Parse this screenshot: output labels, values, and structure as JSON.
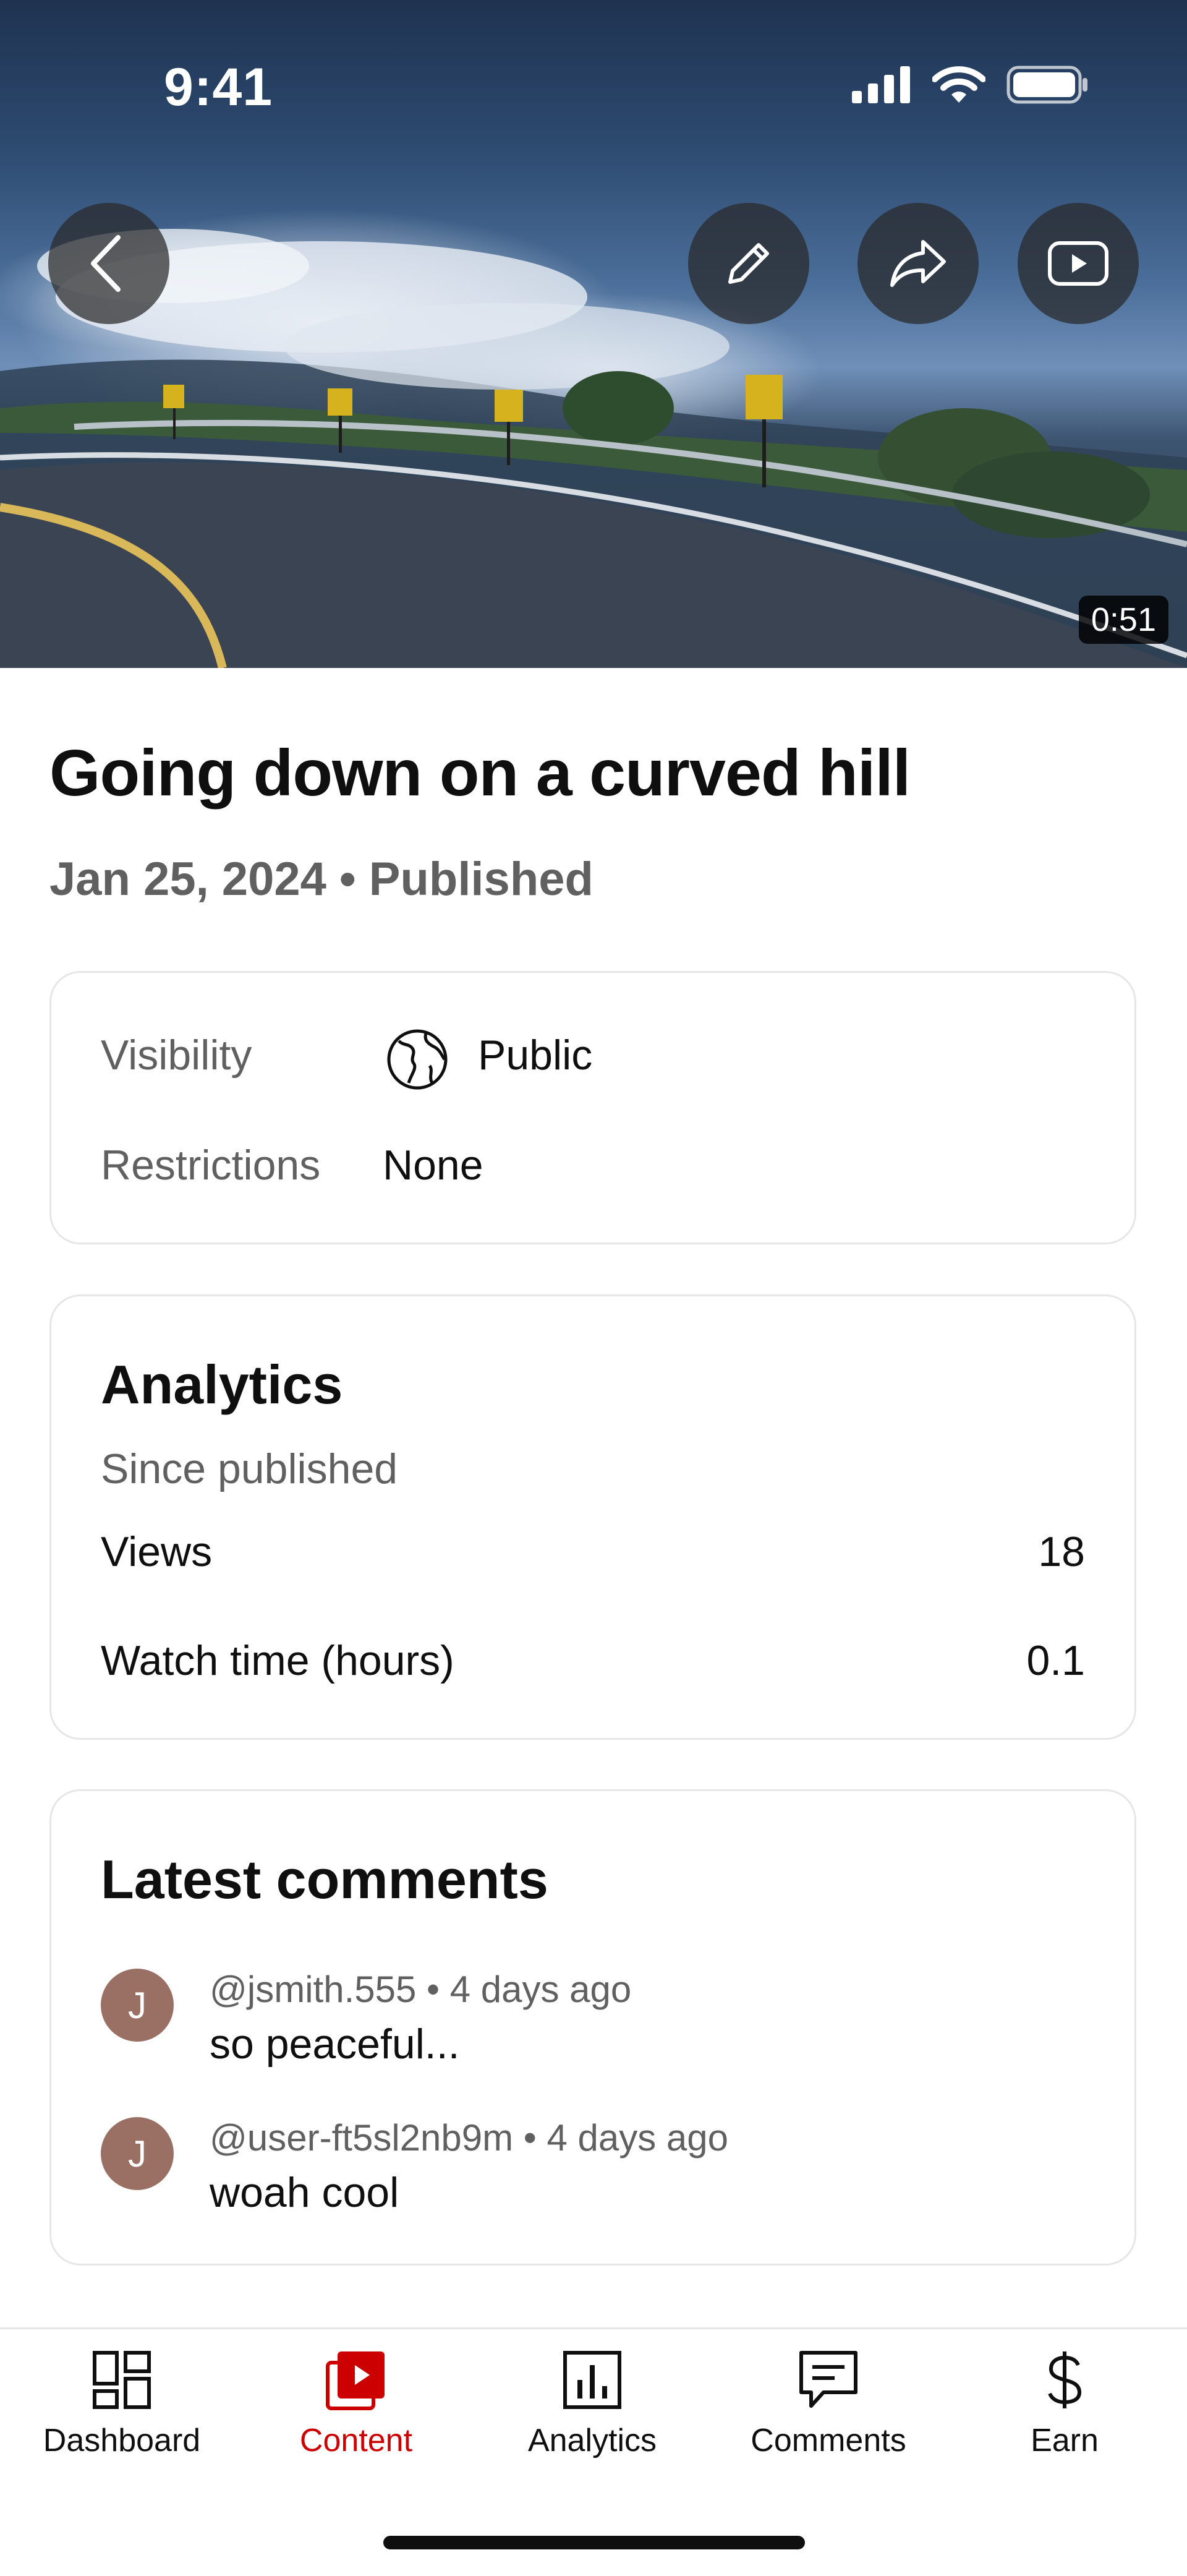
{
  "status_bar": {
    "time": "9:41"
  },
  "video": {
    "duration": "0:51",
    "title": "Going down on a curved hill",
    "date": "Jan 25, 2024",
    "separator": "•",
    "status": "Published"
  },
  "details": {
    "visibility_label": "Visibility",
    "visibility_value": "Public",
    "restrictions_label": "Restrictions",
    "restrictions_value": "None"
  },
  "analytics": {
    "title": "Analytics",
    "subtitle": "Since published",
    "rows": [
      {
        "label": "Views",
        "value": "18"
      },
      {
        "label": "Watch time (hours)",
        "value": "0.1"
      }
    ]
  },
  "comments": {
    "title": "Latest comments",
    "items": [
      {
        "initial": "J",
        "handle": "@jsmith.555",
        "separator": "•",
        "time": "4 days ago",
        "text": "so peaceful..."
      },
      {
        "initial": "J",
        "handle": "@user-ft5sl2nb9m",
        "separator": "•",
        "time": "4 days ago",
        "text": "woah cool"
      }
    ]
  },
  "nav": {
    "active": "Content",
    "items": [
      {
        "label": "Dashboard",
        "icon": "dashboard-icon"
      },
      {
        "label": "Content",
        "icon": "content-icon"
      },
      {
        "label": "Analytics",
        "icon": "analytics-icon"
      },
      {
        "label": "Comments",
        "icon": "comments-icon"
      },
      {
        "label": "Earn",
        "icon": "dollar-icon"
      }
    ]
  },
  "colors": {
    "accent": "#cc0000",
    "avatar": "#9a6f64"
  }
}
